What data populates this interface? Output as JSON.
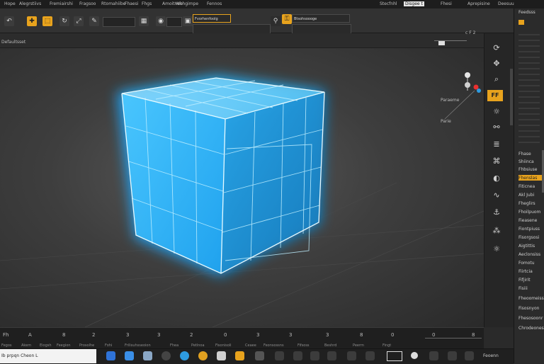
{
  "menu": {
    "items": [
      "Hope",
      "Alegrstiivs",
      "Fremiairshi",
      "Fragsoo",
      "Rtomahiibe",
      "Fhaesi",
      "Fhgs",
      "Amoitnoo",
      "Wkhgimpe",
      "Fennos"
    ],
    "right": [
      "Stecfnhl",
      "Disgee t",
      "Fhesi",
      "Aprepisine",
      "Deesuu"
    ]
  },
  "toolbar": {
    "mode_field": "Fvorhenfoolg",
    "tool_field": "Btsohsoooge"
  },
  "view": {
    "label": "Defaultsset",
    "corner_readout": "c F 2",
    "orient_top": "Paraeme",
    "orient_side": "Parie",
    "orient_badge": "FF"
  },
  "panel": {
    "header": "Feedsss",
    "items": [
      "Fhase",
      "Shiinca",
      "Fhbsiuse",
      "Fhenslas",
      "Fiticnea",
      "Akl Jubi",
      "Fheglirs",
      "Fhoilpuom",
      "Fieasene",
      "Fiontpiuss",
      "Fisorgsosi",
      "Aigtittis",
      "Aeclonsiss",
      "Fomotu",
      "Fiirtcia",
      "Fifjirit",
      "Fisiii",
      "Fheoomeiss",
      "Fisosnyon",
      "Fhesosoonr",
      "Chrodeones"
    ]
  },
  "timeline": {
    "ticks": [
      "Fh",
      "A",
      "8",
      "2",
      "3",
      "3",
      "2",
      "0",
      "3",
      "3",
      "3",
      "8",
      "0",
      "0",
      "8"
    ],
    "labels": [
      "Fegos",
      "Akem",
      "Eiogsh",
      "Feegion",
      "Prosolhe",
      "Fohi",
      "Frilisuhsseoion",
      "Fhea",
      "Petlnoa",
      "Fisonisoli",
      "Ceaee",
      "Feonsossns",
      "Fifsoss",
      "Beshrd",
      "Peerm",
      "Fingt"
    ]
  },
  "taskbar": {
    "search": "Ib prpqn Cheon L",
    "clock": "Feoenn"
  },
  "colors": {
    "accent": "#e8a31d",
    "wire": "#27b6f2",
    "glow": "#18a8ff"
  }
}
